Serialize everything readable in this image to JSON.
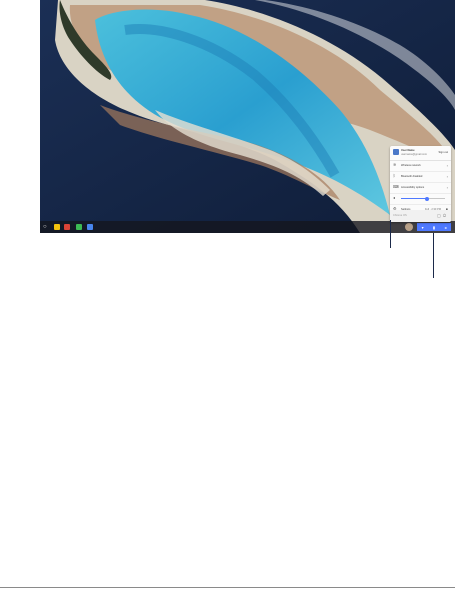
{
  "wallpaper": {
    "description_icon": "atoll-wallpaper"
  },
  "shelf": {
    "launcher_icon": "launcher-icon",
    "apps": [
      {
        "name": "chrome-app-icon",
        "color": "#f4c20d"
      },
      {
        "name": "gmail-app-icon",
        "color": "#db4437"
      },
      {
        "name": "photos-app-icon",
        "color": "#3cba54"
      },
      {
        "name": "docs-app-icon",
        "color": "#4885ed"
      }
    ],
    "status_color": "#4f79ff"
  },
  "tray": {
    "user_name": "User Name",
    "user_email": "username@gmail.com",
    "sign_out": "Sign out",
    "rows": [
      {
        "icon": "wifi-icon",
        "glyph": "≋",
        "label": "Wireless network"
      },
      {
        "icon": "bluetooth-icon",
        "glyph": "ᛒ",
        "label": "Bluetooth disabled"
      },
      {
        "icon": "keyboard-icon",
        "glyph": "⌨",
        "label": "Accessibility options"
      }
    ],
    "volume": {
      "icon": "volume-icon",
      "level": 0.6
    },
    "settings": {
      "label": "Settings",
      "meta": "Full · 2:30 PM"
    },
    "footer": {
      "text": "Chrome OS"
    }
  }
}
